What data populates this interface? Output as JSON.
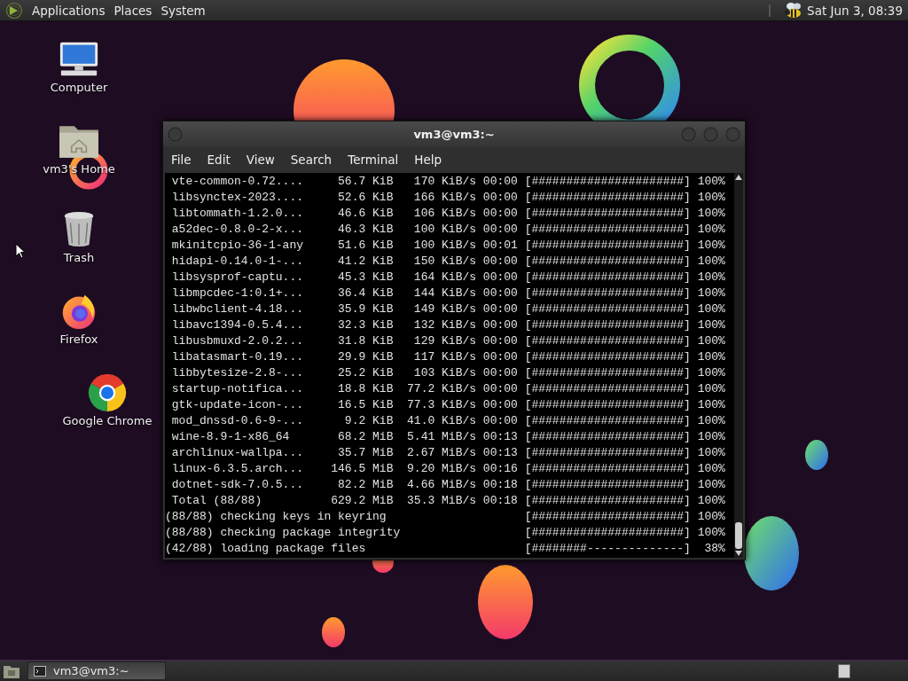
{
  "top_panel": {
    "menus": [
      "Applications",
      "Places",
      "System"
    ],
    "clock": "Sat Jun 3, 08:39"
  },
  "desktop_icons": [
    {
      "kind": "computer",
      "label": "Computer"
    },
    {
      "kind": "home",
      "label": "vm3's Home"
    },
    {
      "kind": "trash",
      "label": "Trash"
    },
    {
      "kind": "firefox",
      "label": "Firefox"
    },
    {
      "kind": "chrome",
      "label": "Google Chrome"
    }
  ],
  "terminal": {
    "title": "vm3@vm3:~",
    "menu": [
      "File",
      "Edit",
      "View",
      "Search",
      "Terminal",
      "Help"
    ],
    "lines": [
      " vte-common-0.72....     56.7 KiB   170 KiB/s 00:00 [######################] 100%",
      " libsynctex-2023....     52.6 KiB   166 KiB/s 00:00 [######################] 100%",
      " libtommath-1.2.0...     46.6 KiB   106 KiB/s 00:00 [######################] 100%",
      " a52dec-0.8.0-2-x...     46.3 KiB   100 KiB/s 00:00 [######################] 100%",
      " mkinitcpio-36-1-any     51.6 KiB   100 KiB/s 00:01 [######################] 100%",
      " hidapi-0.14.0-1-...     41.2 KiB   150 KiB/s 00:00 [######################] 100%",
      " libsysprof-captu...     45.3 KiB   164 KiB/s 00:00 [######################] 100%",
      " libmpcdec-1:0.1+...     36.4 KiB   144 KiB/s 00:00 [######################] 100%",
      " libwbclient-4.18...     35.9 KiB   149 KiB/s 00:00 [######################] 100%",
      " libavc1394-0.5.4...     32.3 KiB   132 KiB/s 00:00 [######################] 100%",
      " libusbmuxd-2.0.2...     31.8 KiB   129 KiB/s 00:00 [######################] 100%",
      " libatasmart-0.19...     29.9 KiB   117 KiB/s 00:00 [######################] 100%",
      " libbytesize-2.8-...     25.2 KiB   103 KiB/s 00:00 [######################] 100%",
      " startup-notifica...     18.8 KiB  77.2 KiB/s 00:00 [######################] 100%",
      " gtk-update-icon-...     16.5 KiB  77.3 KiB/s 00:00 [######################] 100%",
      " mod_dnssd-0.6-9-...      9.2 KiB  41.0 KiB/s 00:00 [######################] 100%",
      " wine-8.9-1-x86_64       68.2 MiB  5.41 MiB/s 00:13 [######################] 100%",
      " archlinux-wallpa...     35.7 MiB  2.67 MiB/s 00:13 [######################] 100%",
      " linux-6.3.5.arch...    146.5 MiB  9.20 MiB/s 00:16 [######################] 100%",
      " dotnet-sdk-7.0.5...     82.2 MiB  4.66 MiB/s 00:18 [######################] 100%",
      " Total (88/88)          629.2 MiB  35.3 MiB/s 00:18 [######################] 100%",
      "(88/88) checking keys in keyring                    [######################] 100%",
      "(88/88) checking package integrity                  [######################] 100%",
      "(42/88) loading package files                       [########--------------]  38%"
    ]
  },
  "taskbar": {
    "tasks": [
      {
        "label": "vm3@vm3:~"
      }
    ]
  }
}
